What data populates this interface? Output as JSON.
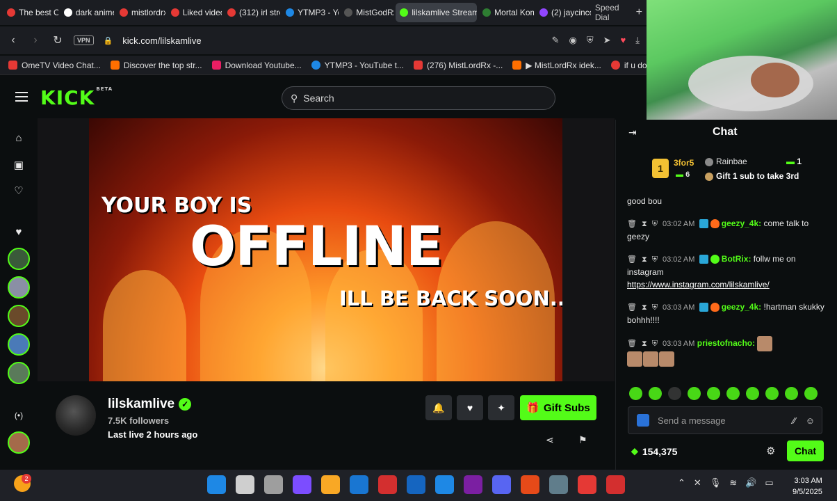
{
  "browser": {
    "tabs": [
      {
        "label": "The best Cl",
        "color": "#e53935"
      },
      {
        "label": "dark anime",
        "color": "#ffffff"
      },
      {
        "label": "mistlordrx",
        "color": "#e53935"
      },
      {
        "label": "Liked video",
        "color": "#e53935"
      },
      {
        "label": "(312) irl stre",
        "color": "#e53935"
      },
      {
        "label": "YTMP3 - Yo",
        "color": "#1e88e5"
      },
      {
        "label": "MistGodRx",
        "color": "#555555"
      },
      {
        "label": "lilskamlive Stream -",
        "color": "#53fc18"
      },
      {
        "label": "Mortal Kom",
        "color": "#2e7d32"
      },
      {
        "label": "(2) jaycinco",
        "color": "#9146ff"
      }
    ],
    "speed_dial": "Speed Dial",
    "new_tab": "+",
    "vpn_label": "VPN",
    "url": "kick.com/lilskamlive",
    "bookmarks": [
      {
        "label": "OmeTV Video Chat...",
        "color": "#e53935"
      },
      {
        "label": "Discover the top str...",
        "color": "#ff6f00"
      },
      {
        "label": "Download Youtube...",
        "color": "#e91e63"
      },
      {
        "label": "YTMP3 - YouTube t...",
        "color": "#1e88e5"
      },
      {
        "label": "(276) MistLordRx -...",
        "color": "#e53935"
      },
      {
        "label": "▶ MistLordRx idek...",
        "color": "#ff6f00"
      },
      {
        "label": "if u dont like it you b...",
        "color": "#e53935"
      }
    ]
  },
  "kick": {
    "logo": "KICK",
    "logo_tag": "BETA",
    "search_placeholder": "Search"
  },
  "poster": {
    "line1": "YOUR BOY IS",
    "line2": "OFFLINE",
    "line3": "ILL BE BACK SOON...."
  },
  "channel": {
    "name": "lilskamlive",
    "followers": "7.5K followers",
    "last_live": "Last live 2 hours ago",
    "gift_subs_label": "Gift Subs"
  },
  "chat": {
    "title": "Chat",
    "leaderboard": {
      "first_name": "3for5",
      "first_count": "6",
      "second_name": "Rainbae",
      "second_count": "1",
      "gift_prompt": "Gift 1 sub to take 3rd"
    },
    "messages": [
      {
        "time": "",
        "user": "",
        "user_color": "#53fc18",
        "text": "good bou"
      },
      {
        "time": "03:02 AM",
        "user": "geezy_4k:",
        "user_color": "#53fc18",
        "text": "come talk to geezy"
      },
      {
        "time": "03:02 AM",
        "user": "BotRix:",
        "user_color": "#53fc18",
        "text": "follw me on instagram",
        "link": "https://www.instagram.com/lilskamlive/"
      },
      {
        "time": "03:03 AM",
        "user": "geezy_4k:",
        "user_color": "#53fc18",
        "text": "!hartman skukky bohhh!!!!"
      },
      {
        "time": "03:03 AM",
        "user": "priestofnacho:",
        "user_color": "#53fc18",
        "text": ""
      }
    ],
    "input_placeholder": "Send a message",
    "points": "154,375",
    "send_label": "Chat"
  },
  "taskbar": {
    "time": "3:03 AM",
    "date": "9/5/2025",
    "notification_count": "2",
    "icon_colors": [
      "#1e88e5",
      "#cfcfcf",
      "#9e9e9e",
      "#7c4dff",
      "#f9a825",
      "#1976d2",
      "#d32f2f",
      "#1565c0",
      "#1e88e5",
      "#7b1fa2",
      "#5865f2",
      "#e64a19",
      "#607d8b",
      "#e53935",
      "#d32f2f"
    ]
  }
}
